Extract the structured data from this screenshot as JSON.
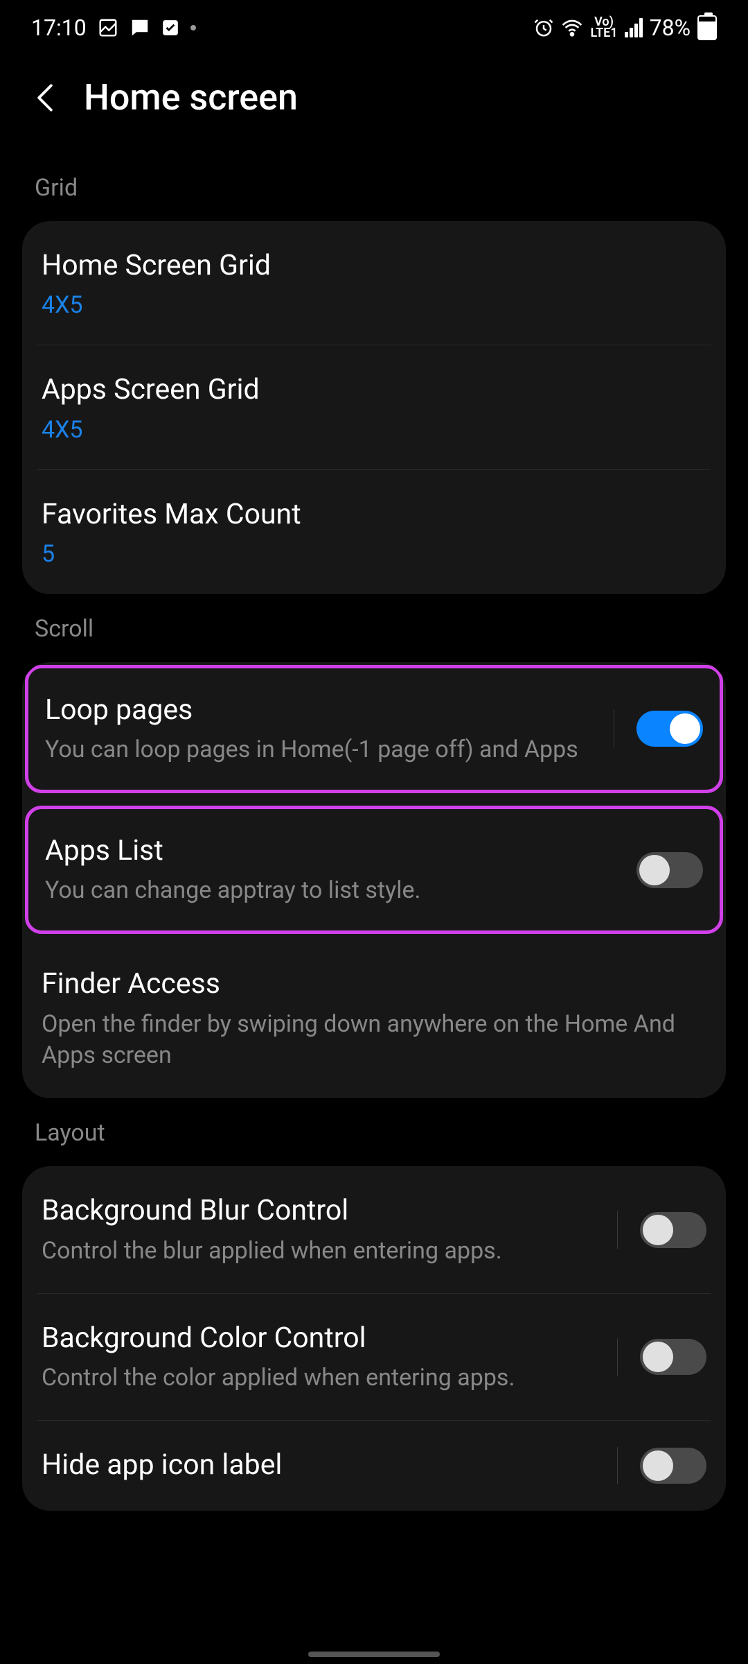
{
  "status": {
    "time": "17:10",
    "battery": "78%"
  },
  "header": {
    "title": "Home screen"
  },
  "sections": {
    "grid": {
      "label": "Grid",
      "items": {
        "home_grid": {
          "title": "Home Screen Grid",
          "value": "4X5"
        },
        "apps_grid": {
          "title": "Apps Screen Grid",
          "value": "4X5"
        },
        "favorites": {
          "title": "Favorites Max Count",
          "value": "5"
        }
      }
    },
    "scroll": {
      "label": "Scroll",
      "items": {
        "loop": {
          "title": "Loop pages",
          "desc": "You can loop pages in Home(-1 page off) and Apps"
        },
        "apps_list": {
          "title": "Apps List",
          "desc": "You can change apptray to list style."
        },
        "finder": {
          "title": "Finder Access",
          "desc": "Open the finder by swiping down anywhere on the Home And Apps screen"
        }
      }
    },
    "layout": {
      "label": "Layout",
      "items": {
        "blur": {
          "title": "Background Blur Control",
          "desc": "Control the blur applied when entering apps."
        },
        "color": {
          "title": "Background Color Control",
          "desc": "Control the color applied when entering apps."
        },
        "hide_label": {
          "title": "Hide app icon label"
        }
      }
    }
  }
}
